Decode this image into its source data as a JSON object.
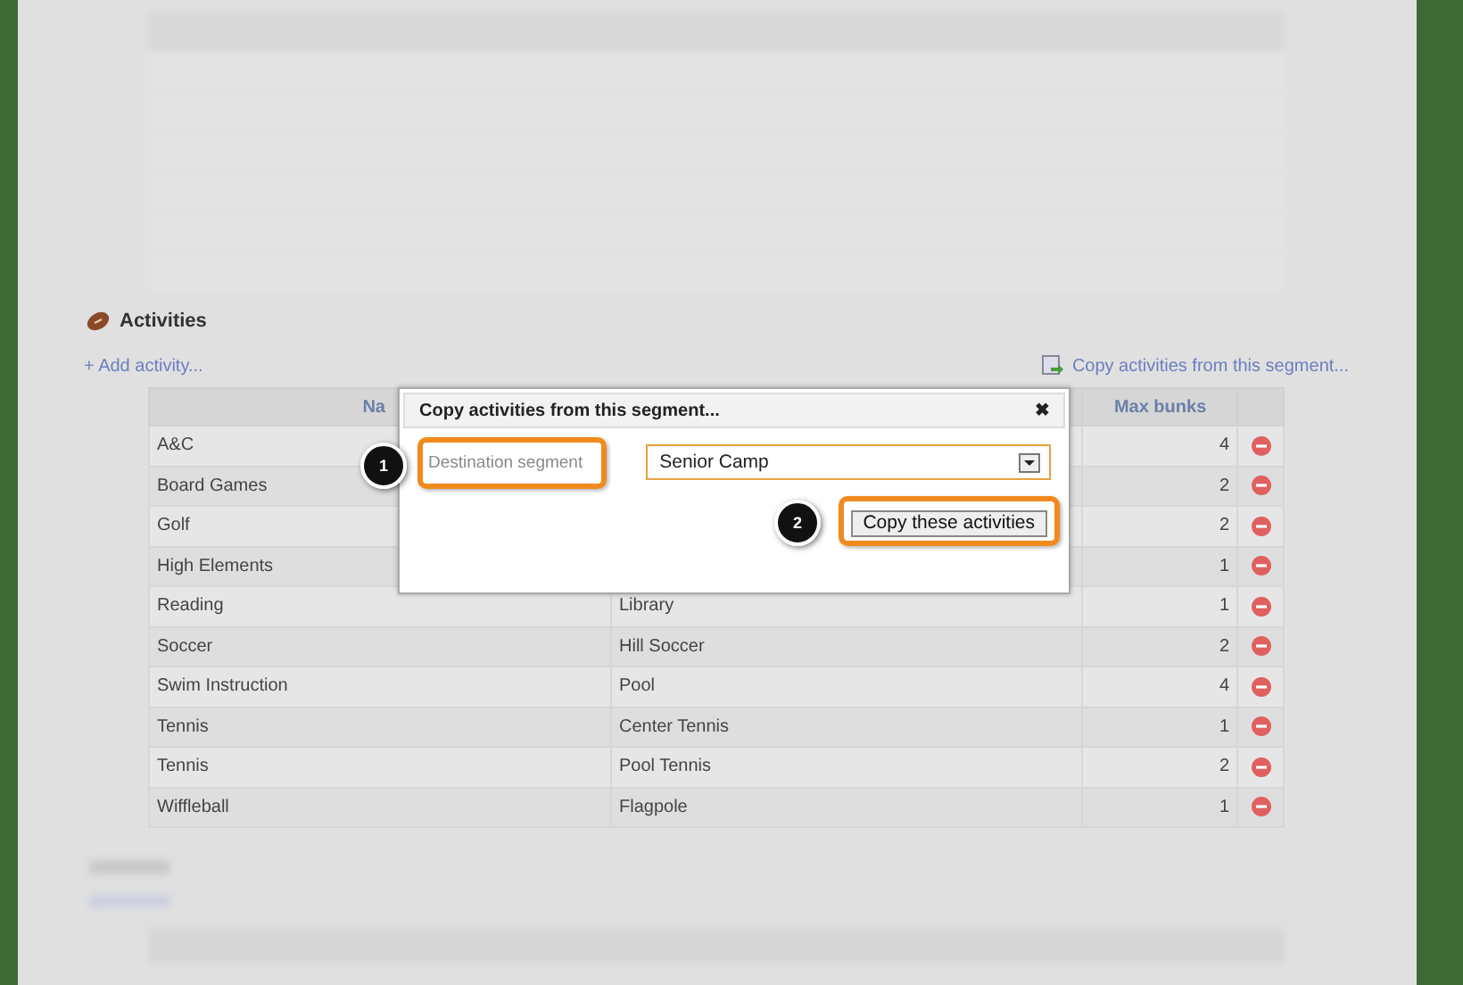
{
  "section": {
    "title": "Activities"
  },
  "links": {
    "add": "+ Add activity...",
    "copy": "Copy activities from this segment..."
  },
  "table": {
    "columns": [
      {
        "label": "Na"
      },
      {
        "label": "Max bunks"
      }
    ],
    "rows": [
      {
        "name": "A&C",
        "max": "4"
      },
      {
        "name": "Board Games",
        "max": "2"
      },
      {
        "name": "Golf",
        "max": "2"
      },
      {
        "name": "High Elements",
        "max": "1"
      },
      {
        "name": "Reading",
        "location": "Library",
        "max": "1"
      },
      {
        "name": "Soccer",
        "location": "Hill Soccer",
        "max": "2"
      },
      {
        "name": "Swim Instruction",
        "location": "Pool",
        "max": "4"
      },
      {
        "name": "Tennis",
        "location": "Center Tennis",
        "max": "1"
      },
      {
        "name": "Tennis",
        "location": "Pool Tennis",
        "max": "2"
      },
      {
        "name": "Wiffleball",
        "location": "Flagpole",
        "max": "1"
      }
    ]
  },
  "dialog": {
    "title": "Copy activities from this segment...",
    "close": "✖",
    "label": "Destination segment",
    "select_value": "Senior Camp",
    "button": "Copy these activities",
    "callouts": [
      "1",
      "2"
    ]
  }
}
